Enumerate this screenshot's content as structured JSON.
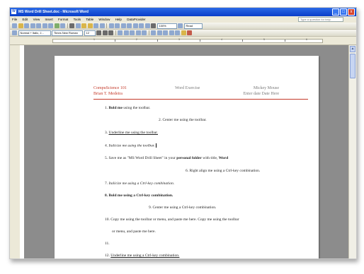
{
  "window": {
    "title": "MS Word Drill Sheet.doc - Microsoft Word",
    "icon_text": "W",
    "buttons": [
      "_",
      "□",
      "x"
    ]
  },
  "menu": {
    "items": [
      "File",
      "Edit",
      "View",
      "Insert",
      "Format",
      "Tools",
      "Table",
      "Window",
      "Help",
      "DataProvider"
    ],
    "help_placeholder": "Type a question for help"
  },
  "toolbar": {
    "zoom": "100%",
    "read_label": "Read",
    "style_value": "Normal + Italic, J...",
    "font_value": "Times New Roman",
    "size_value": "12"
  },
  "ruler": {
    "numbers": [
      "1",
      "2",
      "3",
      "4",
      "5",
      "6"
    ]
  },
  "document": {
    "header": {
      "course": "CompuScience 101",
      "name_line": "Brian T. Medeira",
      "center": "Word Exercise",
      "right_name": "Mickey Mouse",
      "right_date": "Enter date Date Here"
    },
    "lines": [
      {
        "num": "1.",
        "bold": "Bold me",
        "rest": " using the toolbar."
      },
      {
        "num": "2.",
        "text": "Center me using the toolbar."
      },
      {
        "num": "3.",
        "text": "Underline me using the toolbar."
      },
      {
        "num": "4.",
        "text": "Italicize me using the toolbar."
      },
      {
        "num": "5.",
        "pre": "Save me as \"MS Word Drill Sheet\" in your ",
        "bold": "personal folder",
        "mid": " with title, ",
        "bold2": "Word"
      },
      {
        "num": "6.",
        "text": "Right align me using a Ctrl-key combination."
      },
      {
        "num": "7.",
        "text": "Italicize me using a Ctrl-key combination."
      },
      {
        "num": "8.",
        "text": "Bold me using a Ctrl-key combination."
      },
      {
        "num": "9.",
        "text": "Center me using a Ctrl-key combination."
      },
      {
        "num": "10.",
        "text": "Copy me using the toolbar or menu, and paste me here. Copy me using the toolbar"
      },
      {
        "num": "",
        "text": "or menu, and paste me here."
      },
      {
        "num": "11.",
        "text": ""
      },
      {
        "num": "12.",
        "text": "Underline me using a Ctrl-key combination."
      }
    ]
  }
}
